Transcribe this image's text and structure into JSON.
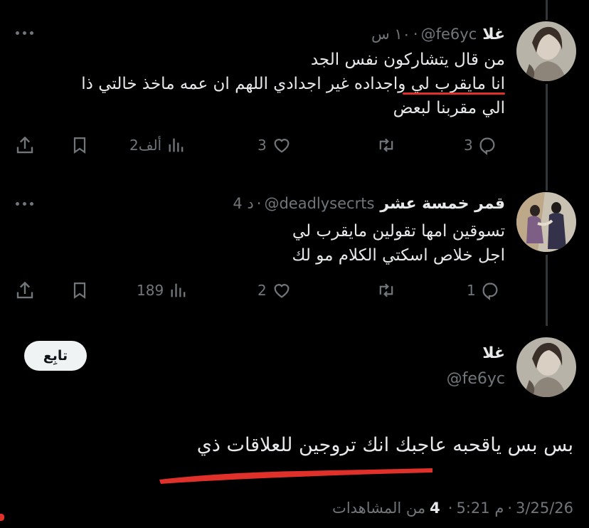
{
  "colors": {
    "background": "#000000",
    "text": "#e7e9ea",
    "muted": "#71767b",
    "annotation_red": "#e0302a",
    "button_bg": "#eff3f4"
  },
  "reply1": {
    "name": "غلا",
    "handle": "@fe6yc",
    "time": "١٠ س",
    "lines": [
      "من قال يتشاركون نفس الجد",
      "انا مايقرب لي واجداده غير اجدادي اللهم ان عمه ماخذ خالتي ذا",
      "الي مقربنا لبعض"
    ],
    "replies": "3",
    "retweets": "",
    "likes": "3",
    "views": "2ألف"
  },
  "reply2": {
    "name": "قمر خمسة عشر",
    "handle": "@deadlysecrts",
    "time": "4 د",
    "lines": [
      "تسوقين امها تقولين مايقرب لي",
      "اجل خلاص اسكتي الكلام مو لك"
    ],
    "replies": "1",
    "retweets": "",
    "likes": "2",
    "views": "189"
  },
  "main": {
    "name": "غلا",
    "handle": "@fe6yc",
    "follow_label": "تابِع",
    "text": "بس بس ياقحبه عاجبك انك تروجين للعلاقات ذي",
    "date": "3/25/26",
    "time": "5:21 م",
    "views_count": "4",
    "views_label": "من المشاهدات"
  },
  "icons": [
    "more-icon",
    "reply-icon",
    "retweet-icon",
    "like-icon",
    "views-icon",
    "bookmark-icon",
    "share-icon"
  ]
}
